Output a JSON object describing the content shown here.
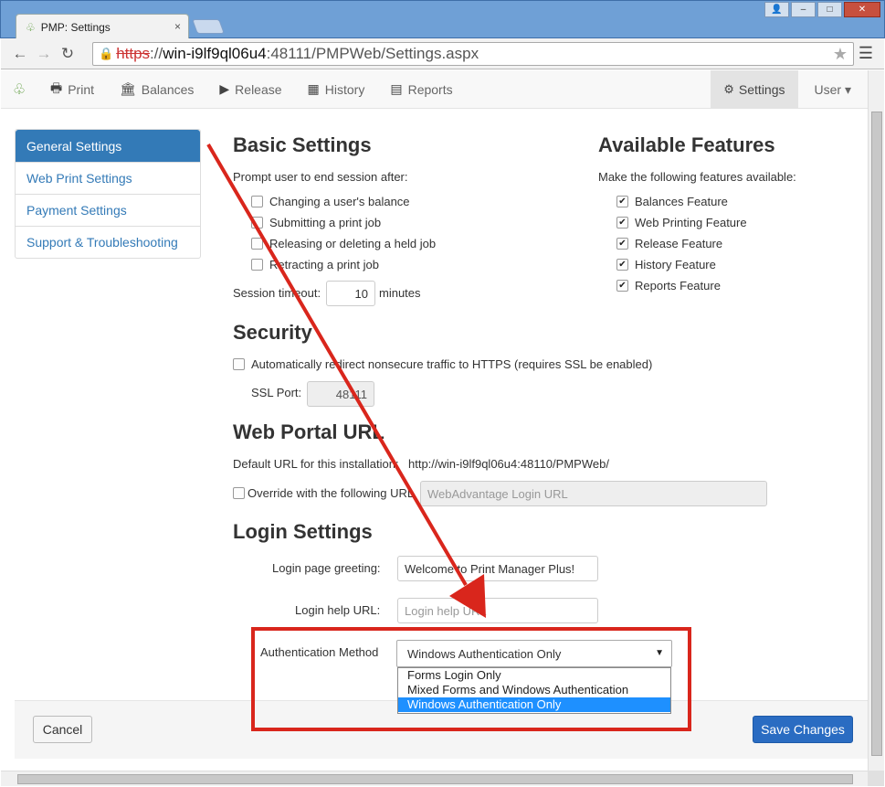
{
  "browser": {
    "tab_title": "PMP: Settings",
    "tab_close": "×",
    "url_protocol": "https",
    "url_host": "win-i9lf9ql06u4",
    "url_rest": ":48111/PMPWeb/Settings.aspx",
    "win_user": "👤",
    "win_min": "–",
    "win_max": "□",
    "win_close": "✕"
  },
  "nav": {
    "items": [
      "Print",
      "Balances",
      "Release",
      "History",
      "Reports"
    ],
    "settings": "Settings",
    "user": "User ▾"
  },
  "sidebar": {
    "items": [
      "General Settings",
      "Web Print Settings",
      "Payment Settings",
      "Support & Troubleshooting"
    ]
  },
  "basic": {
    "title": "Basic Settings",
    "prompt": "Prompt user to end session after:",
    "options": [
      "Changing a user's balance",
      "Submitting a print job",
      "Releasing or deleting a held job",
      "Retracting a print job"
    ],
    "timeout_label": "Session timeout:",
    "timeout_value": "10",
    "timeout_unit": "minutes"
  },
  "features": {
    "title": "Available Features",
    "subtitle": "Make the following features available:",
    "items": [
      "Balances Feature",
      "Web Printing Feature",
      "Release Feature",
      "History Feature",
      "Reports Feature"
    ],
    "check": "✔"
  },
  "security": {
    "title": "Security",
    "redirect": "Automatically redirect nonsecure traffic to HTTPS (requires SSL be enabled)",
    "ssl_label": "SSL Port:",
    "ssl_value": "48111"
  },
  "portal": {
    "title": "Web Portal URL",
    "default_label": "Default URL for this installation:",
    "default_url": "http://win-i9lf9ql06u4:48110/PMPWeb/",
    "override_label": "Override with the following URL",
    "override_placeholder": "WebAdvantage Login URL"
  },
  "login": {
    "title": "Login Settings",
    "greeting_label": "Login page greeting:",
    "greeting_value": "Welcome to Print Manager Plus!",
    "help_label": "Login help URL:",
    "help_placeholder": "Login help URL",
    "auth_label": "Authentication Method",
    "auth_value": "Windows Authentication Only",
    "auth_options": [
      "Forms Login Only",
      "Mixed Forms and Windows Authentication",
      "Windows Authentication Only"
    ]
  },
  "footer": {
    "cancel": "Cancel",
    "save": "Save Changes"
  },
  "colors": {
    "primary": "#337ab7",
    "save": "#2a6cc2",
    "annotation": "#d9261c",
    "dropdown_selected": "#1e90ff"
  }
}
